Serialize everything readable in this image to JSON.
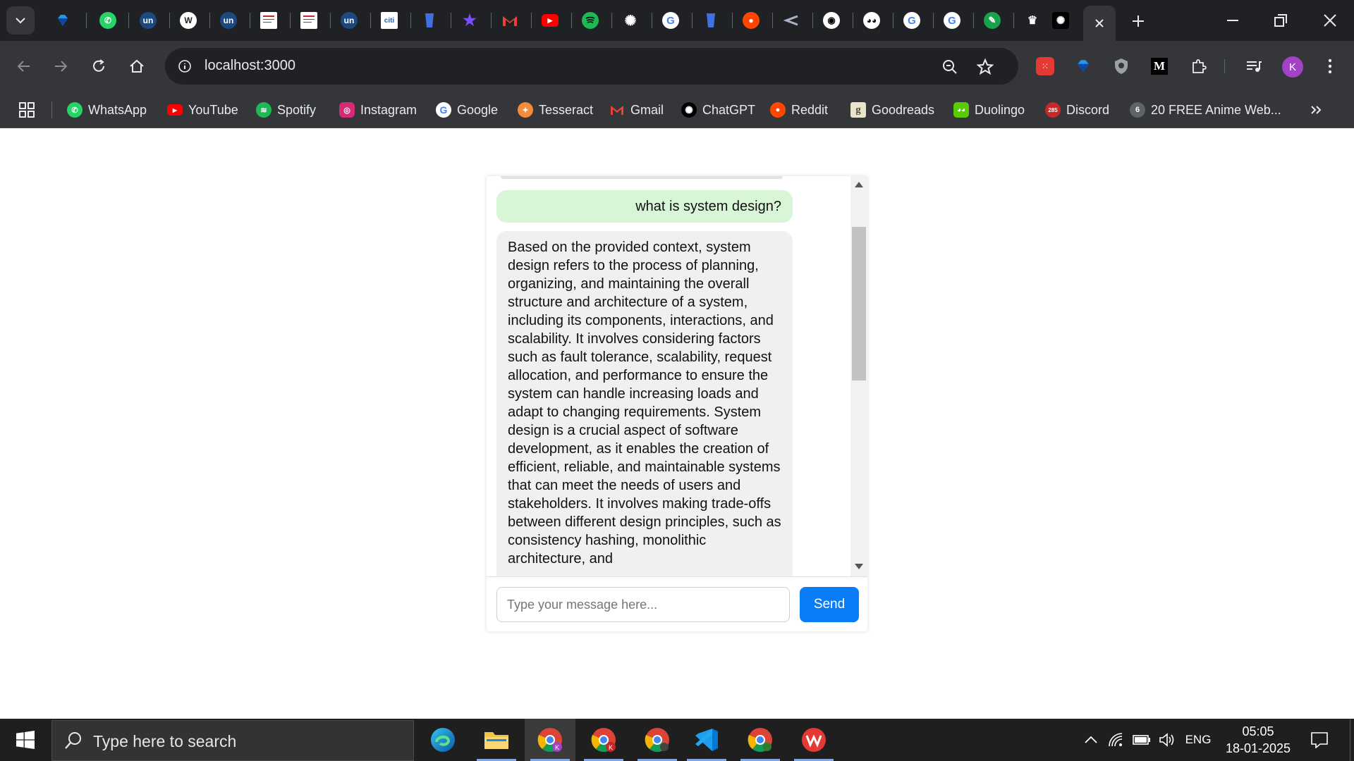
{
  "browser": {
    "address_url": "localhost:3000",
    "profile_initial": "K",
    "colors": {
      "chrome_dark": "#202124",
      "toolbar": "#35363a",
      "avatar": "#a142c7"
    }
  },
  "bookmarks": [
    {
      "label": "WhatsApp",
      "icon": "whatsapp-icon",
      "color": "#25d366"
    },
    {
      "label": "YouTube",
      "icon": "youtube-icon",
      "color": "#ff0000"
    },
    {
      "label": "Spotify",
      "icon": "spotify-icon",
      "color": "#1db954"
    },
    {
      "label": "Instagram",
      "icon": "instagram-icon",
      "color": "#d62976"
    },
    {
      "label": "Google",
      "icon": "google-icon",
      "color": "#ffffff"
    },
    {
      "label": "Tesseract",
      "icon": "tesseract-icon",
      "color": "#f28c38"
    },
    {
      "label": "Gmail",
      "icon": "gmail-icon",
      "color": "#ea4335"
    },
    {
      "label": "ChatGPT",
      "icon": "chatgpt-icon",
      "color": "#000000"
    },
    {
      "label": "Reddit",
      "icon": "reddit-icon",
      "color": "#ff4500"
    },
    {
      "label": "Goodreads",
      "icon": "goodreads-icon",
      "color": "#e9e5cd"
    },
    {
      "label": "Duolingo",
      "icon": "duolingo-icon",
      "color": "#58cc02"
    },
    {
      "label": "Discord",
      "icon": "discord-icon",
      "color": "#c62828"
    },
    {
      "label": "20 FREE Anime Web...",
      "icon": "anime-site-icon",
      "color": "#5f6368"
    }
  ],
  "chat": {
    "user_message": "what is system design?",
    "bot_message": "Based on the provided context, system design refers to the process of planning, organizing, and maintaining the overall structure and architecture of a system, including its components, interactions, and scalability. It involves considering factors such as fault tolerance, scalability, request allocation, and performance to ensure the system can handle increasing loads and adapt to changing requirements. System design is a crucial aspect of software development, as it enables the creation of efficient, reliable, and maintainable systems that can meet the needs of users and stakeholders. It involves making trade-offs between different design principles, such as consistency hashing, monolithic architecture, and",
    "input_placeholder": "Type your message here...",
    "input_value": "",
    "send_label": "Send",
    "colors": {
      "user_bubble": "#d8f5d8",
      "bot_bubble": "#f0f0f0",
      "send_button": "#0a7cf5"
    }
  },
  "taskbar": {
    "search_placeholder": "Type here to search",
    "language": "ENG",
    "time": "05:05",
    "date": "18-01-2025"
  }
}
